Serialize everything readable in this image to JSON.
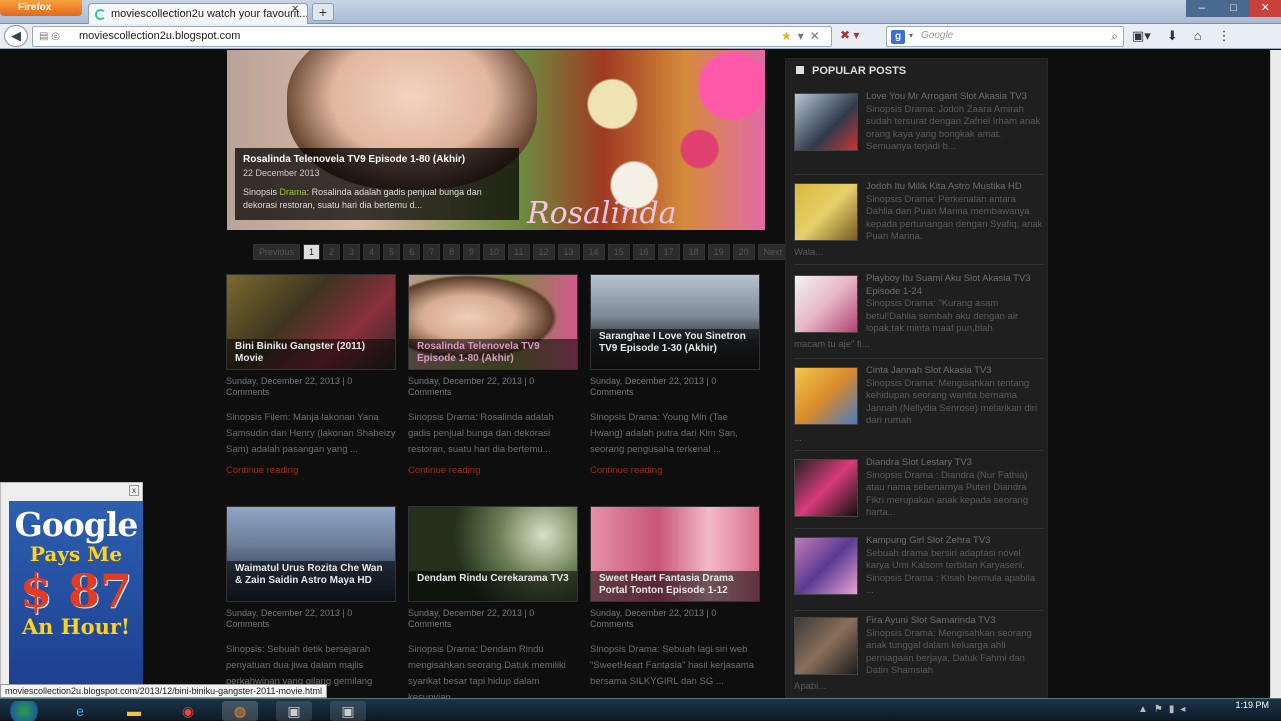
{
  "browser": {
    "app_button": "Firefox",
    "tab_title": "moviescollection2u watch your favourit...",
    "new_tab": "+",
    "url": "moviescollection2u.blogspot.com",
    "search_placeholder": "Google",
    "window_buttons": {
      "minimize": "–",
      "maximize": "□",
      "close": "✕"
    }
  },
  "featured": {
    "title": "Rosalinda Telenovela TV9 Episode 1-80 (Akhir)",
    "date": "22 December 2013",
    "text_prefix": "Sinopsis",
    "text_link": "Drama",
    "text_rest": ": Rosalinda adalah gadis penjual bunga dan dekorasi restoran, suatu hari dia bertemu d...",
    "image_script": "Rosalinda"
  },
  "pager": {
    "prev": "Previous",
    "pages": [
      "1",
      "2",
      "3",
      "4",
      "5",
      "6",
      "7",
      "8",
      "9",
      "10",
      "11",
      "12",
      "13",
      "14",
      "15",
      "16",
      "17",
      "18",
      "19",
      "20"
    ],
    "next": "Next",
    "current": "1"
  },
  "posts": [
    {
      "title": "Bini Biniku Gangster (2011) Movie",
      "meta": "Sunday, December 22, 2013 | 0 Comments",
      "snippet": "Sinopsis Filem: Manja lakonan Yana Samsudin dan Henry (lakonan Shaheizy Sam) adalah pasangan yang ...",
      "more": "Continue reading"
    },
    {
      "title": "Rosalinda Telenovela TV9 Episode 1-80 (Akhir)",
      "meta": "Sunday, December 22, 2013 | 0 Comments",
      "snippet": "Sinopsis Drama: Rosalinda adalah gadis penjual bunga dan dekorasi restoran, suatu hari dia bertemu...",
      "more": "Continue reading"
    },
    {
      "title": "Saranghae I Love You Sinetron TV9 Episode 1-30 (Akhir)",
      "meta": "Sunday, December 22, 2013 | 0 Comments",
      "snippet": "Sinopsis Drama: Young Min (Tae Hwang) adalah putra dari Kim San, seorang pengusaha terkenal ...",
      "more": "Continue reading"
    },
    {
      "title": "Waimatul Urus Rozita Che Wan & Zain Saidin Astro Maya HD",
      "meta": "Sunday, December 22, 2013 | 0 Comments",
      "snippet": "Sinopsis: Sebuah detik bersejarah penyatuan dua jiwa dalam majlis perkahwinan yang gilang gemilang",
      "more": ""
    },
    {
      "title": "Dendam Rindu Cerekarama TV3",
      "meta": "Sunday, December 22, 2013 | 0 Comments",
      "snippet": "Sinopsis Drama: Dendam Rindu mengisahkan seorang Datuk memiliki syarikat besar tapi hidup dalam kesunyian ...",
      "more": ""
    },
    {
      "title": "Sweet Heart Fantasia Drama Portal Tonton Episode 1-12",
      "meta": "Sunday, December 22, 2013 | 0 Comments",
      "snippet": "Sinopsis Drama: Sebuah lagi siri web \"SweetHeart Fantasia\" hasil kerjasama bersama SILKYGIRL dan SG ...",
      "more": ""
    }
  ],
  "popular": {
    "heading": "POPULAR POSTS",
    "items": [
      {
        "title": "Love You Mr Arrogant Slot Akasia TV3",
        "text": "Sinopsis Drama: Jodoh Zaara Amirah sudah tersurat dengan Zafriel Irham anak orang kaya yang bongkak amat. Semuanya terjadi b..."
      },
      {
        "title": "Jodoh Itu Milik Kita Astro Mustika HD",
        "text": "Sinopsis Drama: Perkenalan antara Dahlia dan Puan Marina membawanya kepada pertunangan dengan Syafiq, anak Puan Marina.",
        "tail": "Wala..."
      },
      {
        "title": "Playboy Itu Suami Aku Slot Akasia TV3 Episode 1-24",
        "text": "Sinopsis Drama: \"Kurang asam betul!Dahlia sembah aku dengan air lopak,tak minta maaf pun,blah",
        "tail": "macam tu aje\" fi..."
      },
      {
        "title": "Cinta Jannah Slot Akasia TV3",
        "text": "Sinopsis Drama: Mengisahkan tentang kehidupan seorang wanita bernama Jannah (Nellydia Senrose) melarikan diri dari rumah",
        "tail": "..."
      },
      {
        "title": "Diandra Slot Lestary TV3",
        "text": "Sinopsis Drama : Diandra (Nur Fathia) atau nama sebenarnya Puteri Diandra Fikri merupakan anak kepada seorang harta..."
      },
      {
        "title": "Kampung Girl Slot Zehra TV3",
        "text": "Sebuah drama bersiri adaptasi novel karya Umi Kalsom terbitan Karyaseni. Sinopsis Drama : Kisah bermula apabila ..."
      },
      {
        "title": "Fira Ayuni Slot Samarinda TV3",
        "text": "Sinopsis Drama: Mengisahkan seorang anak tunggal dalam keluarga ahli perniagaan berjaya, Datuk Fahmi dan Datin Shamsiah",
        "tail": "Apabi..."
      }
    ]
  },
  "ad": {
    "close": "x",
    "line1": "Google",
    "line2": "Pays Me",
    "line3": "$ 87",
    "line4": "An Hour!"
  },
  "status_url": "moviescollection2u.blogspot.com/2013/12/bini-biniku-gangster-2011-movie.html",
  "clock": {
    "time": "1:19 PM"
  }
}
